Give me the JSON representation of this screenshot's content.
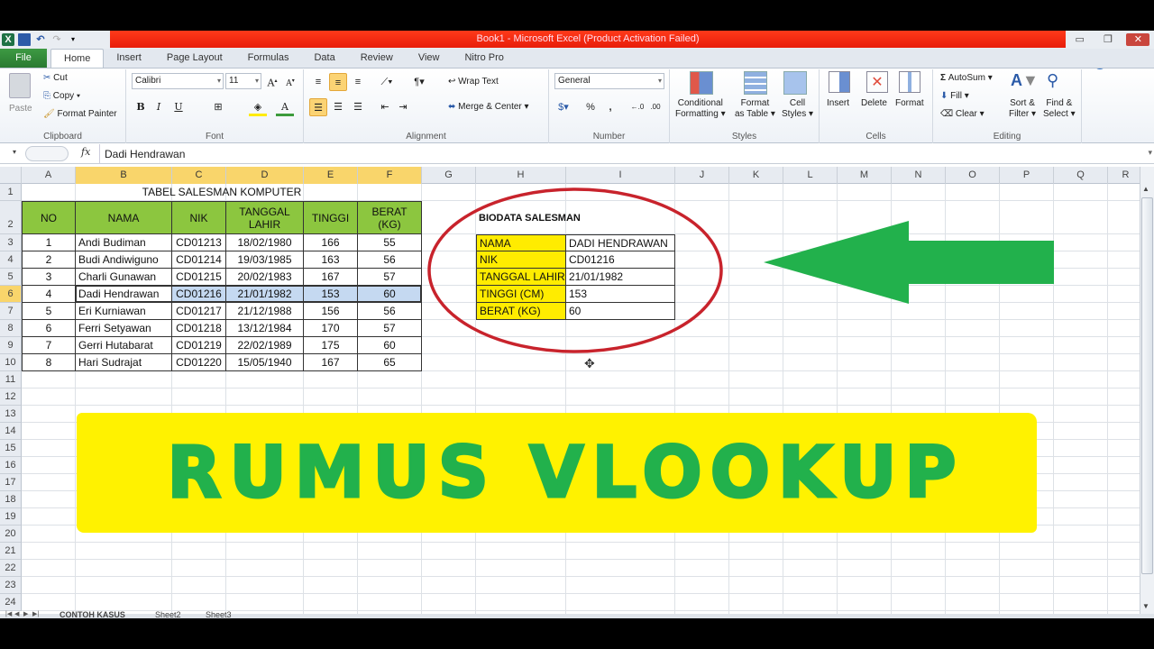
{
  "window": {
    "title": "Book1  -  Microsoft Excel (Product Activation Failed)"
  },
  "qat": {
    "excel_icon": "X",
    "save": "💾",
    "undo": "↶",
    "redo": "↷"
  },
  "tabs": [
    "File",
    "Home",
    "Insert",
    "Page Layout",
    "Formulas",
    "Data",
    "Review",
    "View",
    "Nitro Pro"
  ],
  "active_tab": "Home",
  "ribbon": {
    "clipboard": {
      "label": "Clipboard",
      "paste": "Paste",
      "cut": "Cut",
      "copy": "Copy ▾",
      "format_painter": "Format Painter"
    },
    "font": {
      "label": "Font",
      "font_name": "Calibri",
      "font_size": "11",
      "bold": "B",
      "italic": "I",
      "underline": "U"
    },
    "alignment": {
      "label": "Alignment",
      "wrap_text": "Wrap Text",
      "merge_center": "Merge & Center ▾"
    },
    "number": {
      "label": "Number",
      "format": "General",
      "percent": "%",
      "comma": ","
    },
    "styles": {
      "label": "Styles",
      "conditional": "Conditional",
      "conditional2": "Formatting ▾",
      "format_table": "Format",
      "format_table2": "as Table ▾",
      "cell_styles": "Cell",
      "cell_styles2": "Styles ▾"
    },
    "cells": {
      "label": "Cells",
      "insert": "Insert",
      "delete": "Delete",
      "format": "Format"
    },
    "editing": {
      "label": "Editing",
      "autosum": "AutoSum ▾",
      "fill": "Fill ▾",
      "clear": "Clear ▾",
      "sort": "Sort &",
      "sort2": "Filter ▾",
      "find": "Find &",
      "find2": "Select ▾"
    }
  },
  "formula_bar": {
    "fx": "fx",
    "content": "Dadi Hendrawan"
  },
  "columns": [
    "A",
    "B",
    "C",
    "D",
    "E",
    "F",
    "G",
    "H",
    "I",
    "J",
    "K",
    "L",
    "M",
    "N",
    "O",
    "P",
    "Q",
    "R"
  ],
  "rows": [
    "1",
    "2",
    "3",
    "4",
    "5",
    "6",
    "7",
    "8",
    "9",
    "10",
    "11",
    "12",
    "13",
    "14",
    "15",
    "16",
    "17",
    "18",
    "19",
    "20",
    "21",
    "22",
    "23",
    "24"
  ],
  "main_table": {
    "title": "TABEL SALESMAN KOMPUTER",
    "headers": [
      "NO",
      "NAMA",
      "NIK",
      "TANGGAL LAHIR",
      "TINGGI",
      "BERAT (KG)"
    ],
    "rows": [
      [
        "1",
        "Andi Budiman",
        "CD01213",
        "18/02/1980",
        "166",
        "55"
      ],
      [
        "2",
        "Budi Andiwiguno",
        "CD01214",
        "19/03/1985",
        "163",
        "56"
      ],
      [
        "3",
        "Charli Gunawan",
        "CD01215",
        "20/02/1983",
        "167",
        "57"
      ],
      [
        "4",
        "Dadi Hendrawan",
        "CD01216",
        "21/01/1982",
        "153",
        "60"
      ],
      [
        "5",
        "Eri Kurniawan",
        "CD01217",
        "21/12/1988",
        "156",
        "56"
      ],
      [
        "6",
        "Ferri Setyawan",
        "CD01218",
        "13/12/1984",
        "170",
        "57"
      ],
      [
        "7",
        "Gerri Hutabarat",
        "CD01219",
        "22/02/1989",
        "175",
        "60"
      ],
      [
        "8",
        "Hari Sudrajat",
        "CD01220",
        "15/05/1940",
        "167",
        "65"
      ]
    ]
  },
  "biodata": {
    "title": "BIODATA SALESMAN",
    "rows": [
      {
        "label": "NAMA",
        "value": "DADI HENDRAWAN"
      },
      {
        "label": "NIK",
        "value": "CD01216"
      },
      {
        "label": "TANGGAL LAHIR",
        "value": "21/01/1982"
      },
      {
        "label": "TINGGI (CM)",
        "value": "153"
      },
      {
        "label": "BERAT (KG)",
        "value": "60"
      }
    ]
  },
  "banner": {
    "text": "RUMUS VLOOKUP",
    "bg": "#fff200",
    "fg": "#22b14c"
  },
  "annotations": {
    "ellipse_color": "#c8232c",
    "arrow_color": "#22b14c"
  },
  "sheet_tabs": [
    "CONTOH KASUS",
    "Sheet2",
    "Sheet3"
  ]
}
